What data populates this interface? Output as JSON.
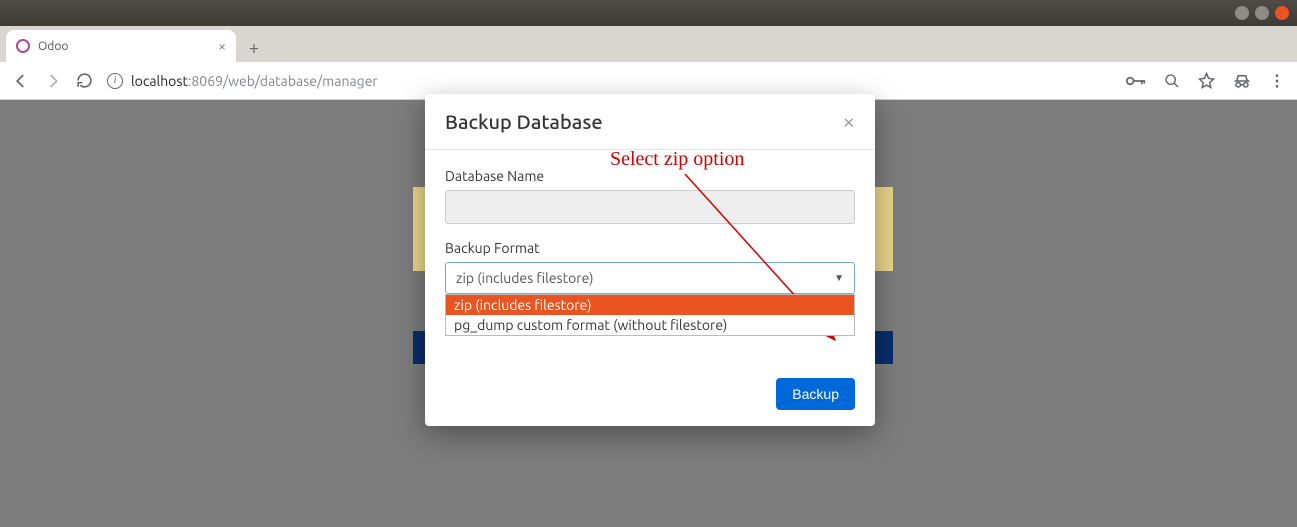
{
  "browser": {
    "tab_title": "Odoo",
    "url_host": "localhost",
    "url_port_path": ":8069/web/database/manager"
  },
  "modal": {
    "title": "Backup Database",
    "db_name_label": "Database Name",
    "db_name_value": "",
    "format_label": "Backup Format",
    "selected_format": "zip (includes filestore)",
    "options": [
      "zip (includes filestore)",
      "pg_dump custom format (without filestore)"
    ],
    "submit_label": "Backup"
  },
  "annotation": {
    "text": "Select zip option"
  }
}
